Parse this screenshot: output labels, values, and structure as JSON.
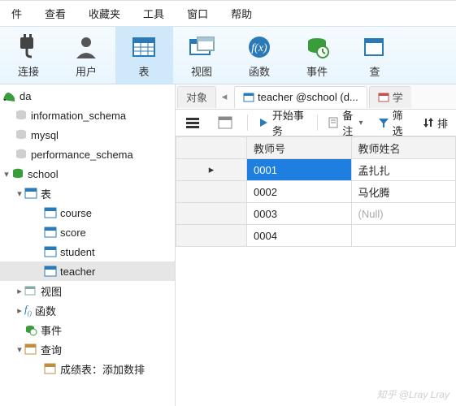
{
  "menu": {
    "items": [
      "件",
      "查看",
      "收藏夹",
      "工具",
      "窗口",
      "帮助"
    ]
  },
  "toolbar": {
    "buttons": [
      {
        "id": "connect",
        "label": "连接"
      },
      {
        "id": "user",
        "label": "用户"
      },
      {
        "id": "table",
        "label": "表",
        "active": true
      },
      {
        "id": "view",
        "label": "视图"
      },
      {
        "id": "func",
        "label": "函数"
      },
      {
        "id": "event",
        "label": "事件"
      },
      {
        "id": "query",
        "label": "查"
      }
    ]
  },
  "tree": {
    "connection": "da",
    "databases": [
      {
        "name": "information_schema",
        "open": false
      },
      {
        "name": "mysql",
        "open": false
      },
      {
        "name": "performance_schema",
        "open": false
      }
    ],
    "open_db": {
      "name": "school",
      "groups": {
        "tables": {
          "label": "表",
          "items": [
            "course",
            "score",
            "student",
            "teacher"
          ],
          "selected": "teacher"
        },
        "views": {
          "label": "视图"
        },
        "funcs": {
          "label": "函数"
        },
        "events": {
          "label": "事件"
        },
        "queries": {
          "label": "查询",
          "items": [
            "成绩表：添加数排"
          ]
        }
      }
    }
  },
  "tabs": {
    "object_tab": "对象",
    "table_tab": "teacher @school (d...",
    "extra_tab": "学"
  },
  "actions": {
    "begin_trans": "开始事务",
    "memo": "备注",
    "filter": "筛选",
    "sort": "排"
  },
  "grid": {
    "columns": [
      "教师号",
      "教师姓名"
    ],
    "rows": [
      {
        "id": "0001",
        "name": "孟扎扎",
        "selected": true
      },
      {
        "id": "0002",
        "name": "马化腾"
      },
      {
        "id": "0003",
        "name": "(Null)",
        "null": true
      },
      {
        "id": "0004",
        "name": ""
      }
    ]
  },
  "watermark": "知乎 @Lray Lray"
}
